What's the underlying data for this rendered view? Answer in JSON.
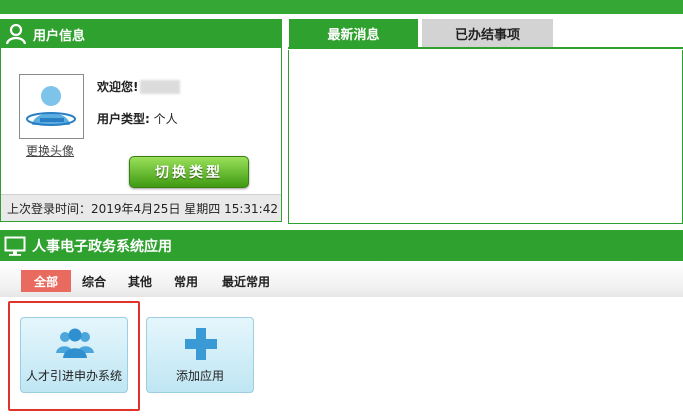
{
  "user_info": {
    "title": "用户信息",
    "welcome_label": "欢迎您!",
    "user_type_label": "用户类型:",
    "user_type_value": "个人",
    "change_avatar": "更换头像",
    "switch_button": "切换类型",
    "last_login": "上次登录时间：2019年4月25日 星期四 15:31:42"
  },
  "news": {
    "tabs": [
      {
        "label": "最新消息",
        "active": true
      },
      {
        "label": "已办结事项",
        "active": false
      }
    ]
  },
  "apps": {
    "title": "人事电子政务系统应用",
    "filters": [
      {
        "label": "全部",
        "active": true
      },
      {
        "label": "综合",
        "active": false
      },
      {
        "label": "其他",
        "active": false
      },
      {
        "label": "常用",
        "active": false
      },
      {
        "label": "最近常用",
        "active": false
      }
    ],
    "cards": [
      {
        "label": "人才引进申办系统",
        "icon": "people-group-icon"
      },
      {
        "label": "添加应用",
        "icon": "plus-icon"
      }
    ]
  },
  "colors": {
    "brand_green": "#2fa12f",
    "filter_active": "#e96a5e",
    "highlight_red": "#e0332b"
  }
}
